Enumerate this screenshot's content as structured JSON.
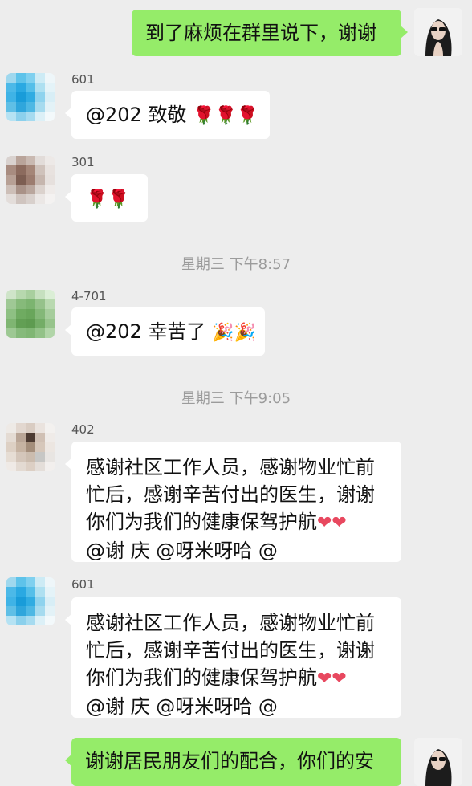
{
  "colors": {
    "background": "#ededed",
    "bubble_in": "#ffffff",
    "bubble_out": "#95ec69",
    "time_text": "#9b9b9b"
  },
  "messages": [
    {
      "sender": "me",
      "text": "到了麻烦在群里说下，谢谢"
    },
    {
      "sender": "601",
      "text": "@202 致敬",
      "emoji": "🌹🌹🌹",
      "emoji_name": "rose-icon"
    },
    {
      "sender": "301",
      "text": "",
      "emoji": "🌹🌹",
      "emoji_name": "rose-icon"
    },
    {
      "time": "星期三 下午8:57"
    },
    {
      "sender": "4-701",
      "text": "@202 幸苦了",
      "emoji": "🎉🎉",
      "emoji_name": "party-popper-icon"
    },
    {
      "time": "星期三 下午9:05"
    },
    {
      "sender": "402",
      "lines": [
        "感谢社区工作人员，感谢物业忙前",
        "忙后，感谢辛苦付出的医生，谢谢",
        "你们为我们的健康保驾护航",
        "@谢  庆 @呀米呀哈 @"
      ],
      "emoji": "❤❤",
      "emoji_name": "heart-icon"
    },
    {
      "sender": "601",
      "lines": [
        "感谢社区工作人员，感谢物业忙前",
        "忙后，感谢辛苦付出的医生，谢谢",
        "你们为我们的健康保驾护航",
        "@谢  庆 @呀米呀哈 @"
      ],
      "emoji": "❤❤",
      "emoji_name": "heart-icon"
    },
    {
      "sender": "me",
      "text": "谢谢居民朋友们的配合，你们的安"
    }
  ],
  "labels": {
    "nick_601": "601",
    "nick_301": "301",
    "nick_4701": "4-701",
    "nick_402": "402",
    "nick_601b": "601",
    "time1": "星期三 下午8:57",
    "time2": "星期三 下午9:05",
    "msg1": "到了麻烦在群里说下，谢谢",
    "msg2": "@202 致敬",
    "msg2_emoji": "🌹🌹🌹",
    "msg3_emoji": "🌹🌹",
    "msg4": "@202 幸苦了",
    "msg4_emoji": "🎉🎉",
    "msg5_l1": "感谢社区工作人员，感谢物业忙前",
    "msg5_l2": "忙后，感谢辛苦付出的医生，谢谢",
    "msg5_l3": "你们为我们的健康保驾护航",
    "msg5_l3_emoji": "❤❤",
    "msg5_l4": "@谢  庆 @呀米呀哈 @",
    "msg6_l1": "感谢社区工作人员，感谢物业忙前",
    "msg6_l2": "忙后，感谢辛苦付出的医生，谢谢",
    "msg6_l3": "你们为我们的健康保驾护航",
    "msg6_l3_emoji": "❤❤",
    "msg6_l4": "@谢  庆 @呀米呀哈 @",
    "msg7": "谢谢居民朋友们的配合，你们的安"
  }
}
